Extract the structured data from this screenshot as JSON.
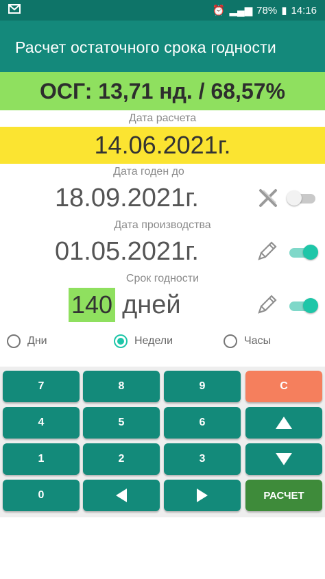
{
  "status_bar": {
    "battery": "78%",
    "time": "14:16"
  },
  "app_bar": {
    "title": "Расчет остаточного срока годности"
  },
  "osg": {
    "text": "ОСГ: 13,71 нд. / 68,57%"
  },
  "calc_date": {
    "label": "Дата расчета",
    "value": "14.06.2021г."
  },
  "expiry": {
    "label": "Дата годен до",
    "value": "18.09.2021г.",
    "toggle_on": false
  },
  "production": {
    "label": "Дата производства",
    "value": "01.05.2021г.",
    "toggle_on": true
  },
  "shelf_life": {
    "label": "Срок годности",
    "value": "140",
    "unit": "дней",
    "toggle_on": true
  },
  "units": {
    "options": [
      "Дни",
      "Недели",
      "Часы"
    ],
    "selected": "Недели"
  },
  "keypad": {
    "k7": "7",
    "k8": "8",
    "k9": "9",
    "clear": "C",
    "k4": "4",
    "k5": "5",
    "k6": "6",
    "k1": "1",
    "k2": "2",
    "k3": "3",
    "k0": "0",
    "calculate": "РАСЧЕТ"
  },
  "colors": {
    "accent": "#14897b",
    "green": "#8fe05f",
    "yellow": "#fbe431",
    "clear": "#f57f5d",
    "calc": "#3e8b3a",
    "toggle": "#1ec6a8"
  }
}
